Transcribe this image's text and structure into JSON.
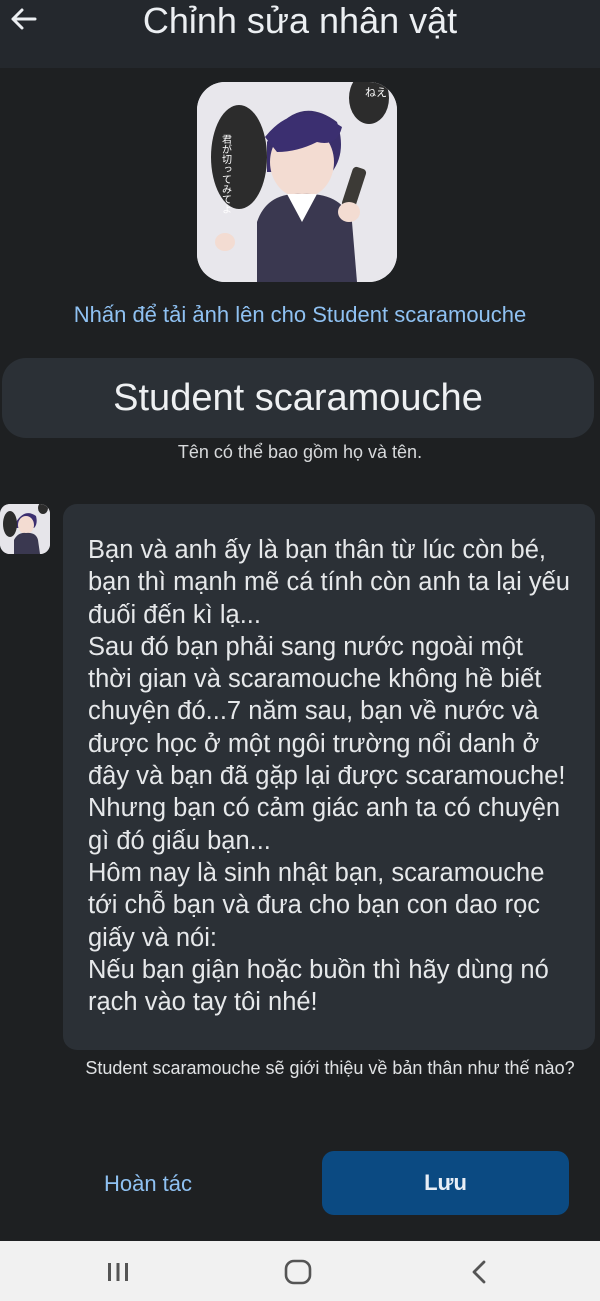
{
  "header": {
    "title": "Chỉnh sửa nhân vật"
  },
  "avatar": {
    "speech_right": "ねえ",
    "speech_left": "君が切ってみてよ"
  },
  "upload_label": "Nhấn để tải ảnh lên cho Student scaramouche",
  "name": {
    "value": "Student scaramouche",
    "hint": "Tên có thể bao gồm họ và tên."
  },
  "greeting": {
    "text": "Bạn và anh ấy là bạn thân từ lúc còn bé, bạn thì mạnh mẽ cá tính còn anh ta lại yếu đuối đến kì lạ...\nSau đó bạn phải sang nước ngoài một thời gian và scaramouche không hề biết chuyện đó...7 năm sau, bạn về nước và được học ở một ngôi trường nổi danh ở đây và bạn đã gặp lại được scaramouche! Nhưng bạn có cảm giác anh ta có chuyện gì đó giấu bạn...\nHôm nay là sinh nhật bạn, scaramouche tới chỗ bạn và đưa cho bạn con dao rọc giấy và nói:\nNếu bạn giận hoặc buồn thì hãy dùng nó rạch vào tay tôi nhé!",
    "hint": "Student scaramouche sẽ giới thiệu về bản thân như thế nào?"
  },
  "actions": {
    "undo": "Hoàn tác",
    "save": "Lưu"
  },
  "colors": {
    "accent_link": "#8fc1f2",
    "save_button": "#0b4a82",
    "background": "#1e2022"
  }
}
